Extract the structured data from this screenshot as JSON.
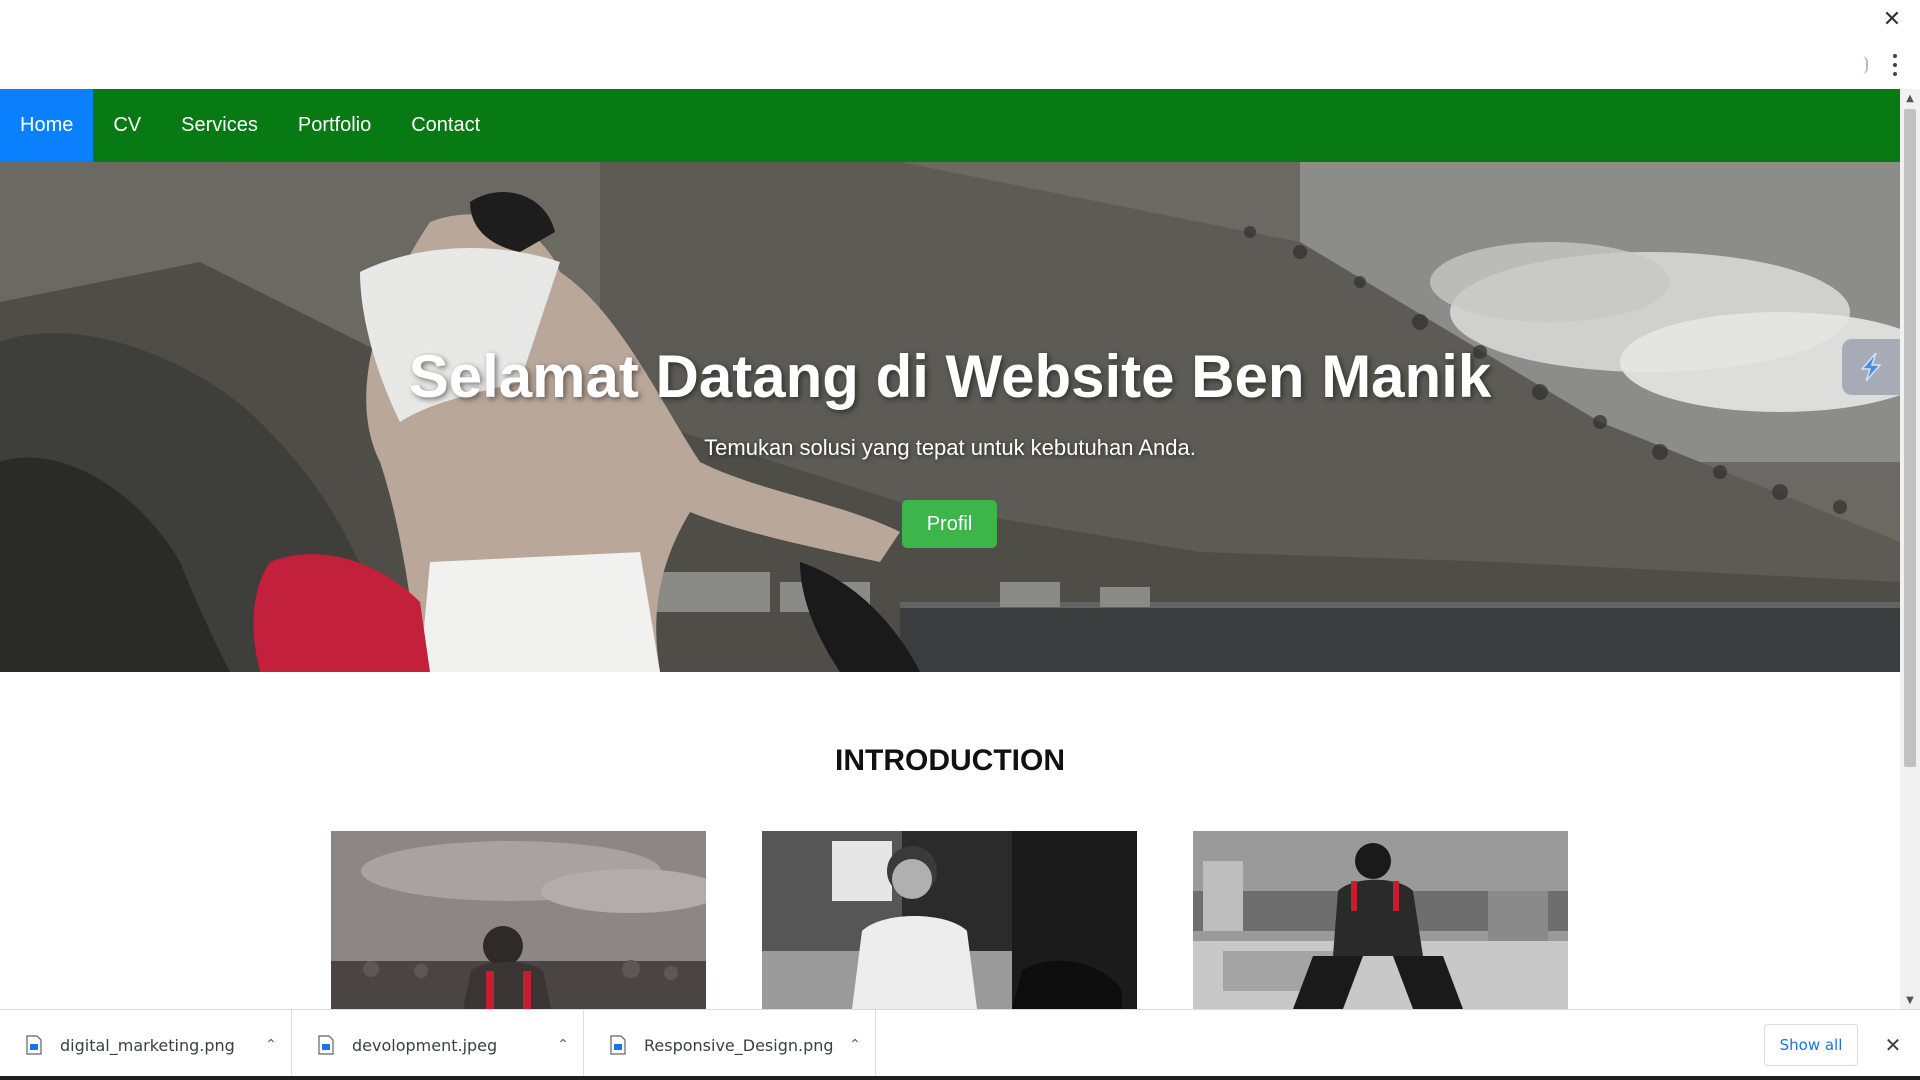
{
  "browser": {
    "close_icon": "close-icon",
    "menu_icon": "kebab-menu-icon"
  },
  "nav": {
    "items": [
      {
        "label": "Home",
        "active": true
      },
      {
        "label": "CV",
        "active": false
      },
      {
        "label": "Services",
        "active": false
      },
      {
        "label": "Portfolio",
        "active": false
      },
      {
        "label": "Contact",
        "active": false
      }
    ],
    "bg_color": "#087a13",
    "active_color": "#0a80ff"
  },
  "hero": {
    "title": "Selamat Datang di Website Ben Manik",
    "subtitle": "Temukan solusi yang tepat untuk kebutuhan Anda.",
    "button_label": "Profil",
    "button_color": "#3cb54a"
  },
  "intro": {
    "title": "INTRODUCTION"
  },
  "downloads": {
    "items": [
      {
        "name": "digital_marketing.png"
      },
      {
        "name": "devolopment.jpeg"
      },
      {
        "name": "Responsive_Design.png"
      }
    ],
    "show_all_label": "Show all"
  }
}
